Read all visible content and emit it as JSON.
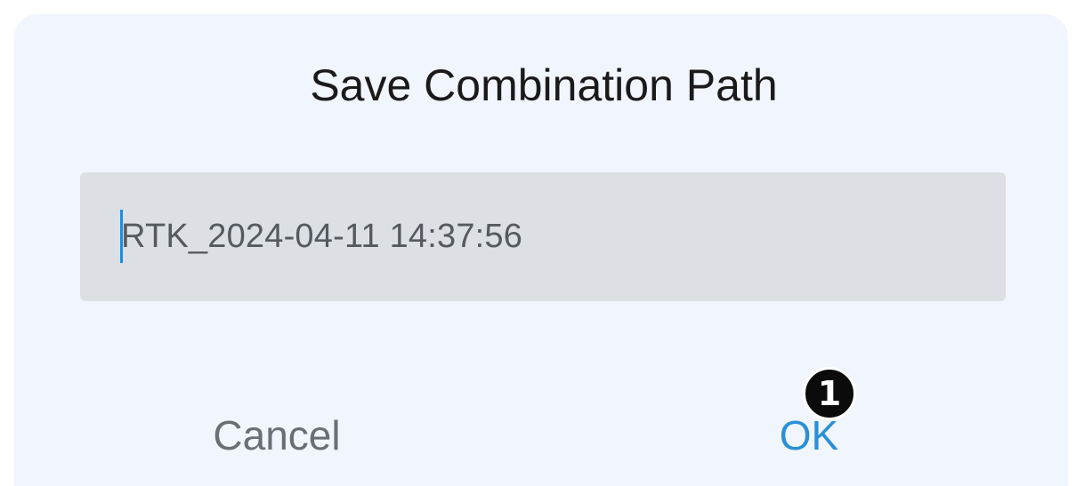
{
  "dialog": {
    "title": "Save Combination Path",
    "input": {
      "value": "RTK_2024-04-11 14:37:56"
    },
    "cancel_label": "Cancel",
    "ok_label": "OK"
  },
  "annotation": {
    "step_number": "1"
  },
  "colors": {
    "dialog_background": "#f1f5fd",
    "input_background": "#dcdfe3",
    "caret": "#1e8de0",
    "ok_accent": "#2a8fd6",
    "cancel_text": "#6b6f74"
  }
}
